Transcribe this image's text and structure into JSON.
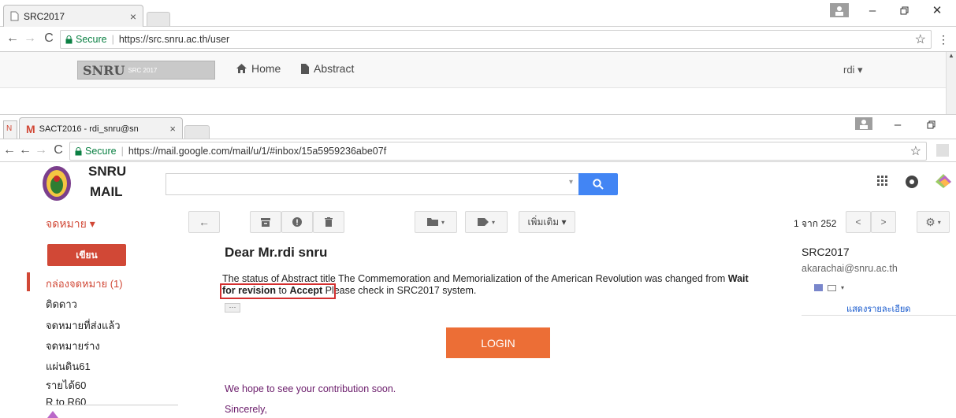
{
  "outer": {
    "tab_title": "SRC2017",
    "close_glyph": "×",
    "secure_label": "Secure",
    "url": "https://src.snru.ac.th/user"
  },
  "src_site": {
    "logo_text": "SNRU",
    "logo_badge": "SRC 2017",
    "nav": [
      {
        "label": "Home",
        "icon": "home-icon"
      },
      {
        "label": "Abstract",
        "icon": "document-icon"
      }
    ],
    "user_menu": "rdi ▾"
  },
  "inner": {
    "tab_title": "SACT2016 - rdi_snru@sn",
    "close_glyph": "×",
    "secure_label": "Secure",
    "url": "https://mail.google.com/mail/u/1/#inbox/15a5959236abe07f"
  },
  "gmail": {
    "brand_line1": "SNRU",
    "brand_line2": "MAIL",
    "mail_label": "จดหมาย ▾",
    "more_label": "เพิ่มเติม ▾",
    "pagination": "1 จาก 252",
    "compose_label": "เขียน",
    "sidebar": [
      {
        "label": "กล่องจดหมาย (1)",
        "active": true
      },
      {
        "label": "ติดดาว",
        "active": false
      },
      {
        "label": "จดหมายที่ส่งแล้ว",
        "active": false
      },
      {
        "label": "จดหมายร่าง",
        "active": false
      },
      {
        "label": "แผ่นดิน61",
        "active": false
      },
      {
        "label": "รายได้60",
        "active": false
      },
      {
        "label": "R to R60",
        "active": false
      }
    ],
    "message": {
      "greeting": "Dear Mr.rdi snru",
      "line1_prefix": "The status of Abstract title The Commemoration and Memorialization of the American Revolution was changed from ",
      "wait": "Wait",
      "for_revision": "for revision",
      "to_word": " to ",
      "accept": "Accept",
      "line2_suffix": " Please check in SRC2017 system.",
      "ellipsis": "···",
      "login_label": "LOGIN",
      "hope": "We hope to see your contribution soon.",
      "sincerely": "Sincerely,"
    },
    "sender": {
      "name": "SRC2017",
      "email": "akarachai@snru.ac.th",
      "details_link": "แสดงรายละเอียด"
    }
  },
  "colors": {
    "accent_red": "#d14836",
    "login_orange": "#ec6e36",
    "search_blue": "#4285f4",
    "highlight_red": "#d32f2f",
    "secure_green": "#0b8043"
  }
}
